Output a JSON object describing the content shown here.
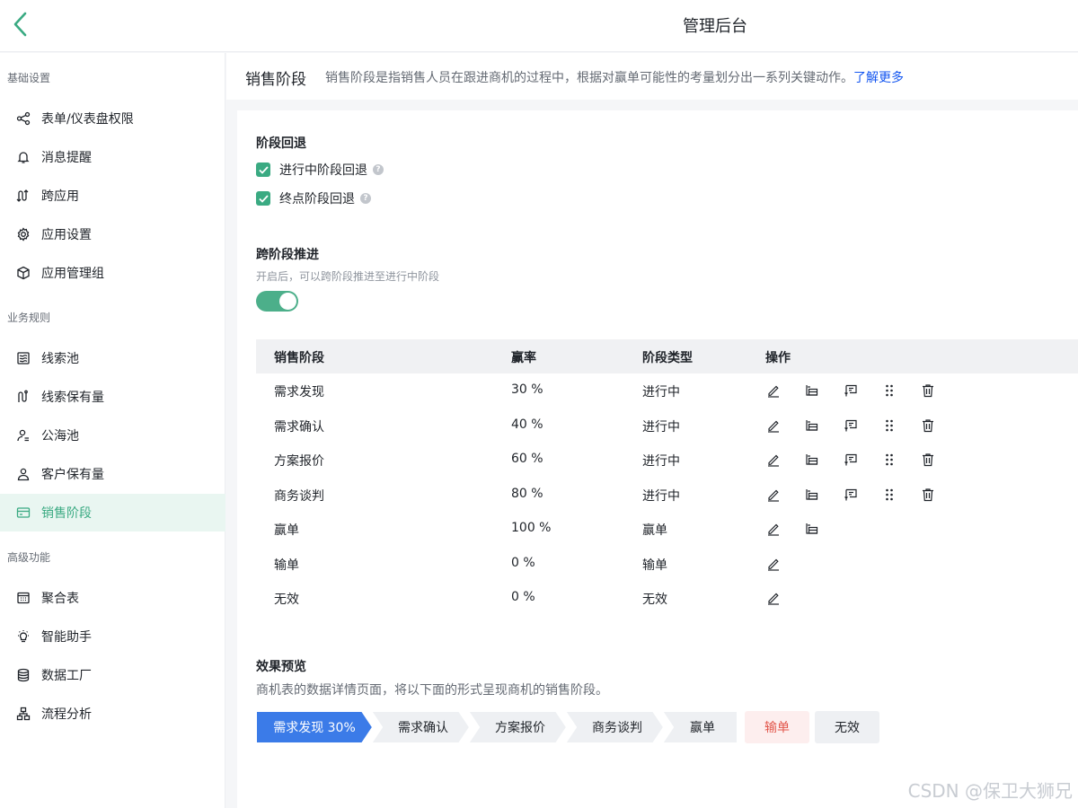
{
  "header": {
    "title": "管理后台"
  },
  "sidebar": {
    "groups": [
      {
        "title": "基础设置",
        "items": [
          {
            "label": "表单/仪表盘权限",
            "icon": "share-icon"
          },
          {
            "label": "消息提醒",
            "icon": "bell-icon"
          },
          {
            "label": "跨应用",
            "icon": "cross-app-icon"
          },
          {
            "label": "应用设置",
            "icon": "gear-icon"
          },
          {
            "label": "应用管理组",
            "icon": "cube-icon"
          }
        ]
      },
      {
        "title": "业务规则",
        "items": [
          {
            "label": "线索池",
            "icon": "pool-icon"
          },
          {
            "label": "线索保有量",
            "icon": "route-icon"
          },
          {
            "label": "公海池",
            "icon": "users-icon"
          },
          {
            "label": "客户保有量",
            "icon": "user-icon"
          },
          {
            "label": "销售阶段",
            "icon": "card-icon",
            "active": true
          }
        ]
      },
      {
        "title": "高级功能",
        "items": [
          {
            "label": "聚合表",
            "icon": "calendar-icon"
          },
          {
            "label": "智能助手",
            "icon": "bulb-icon"
          },
          {
            "label": "数据工厂",
            "icon": "database-icon"
          },
          {
            "label": "流程分析",
            "icon": "flow-icon"
          }
        ]
      }
    ]
  },
  "page": {
    "title": "销售阶段",
    "description": "销售阶段是指销售人员在跟进商机的过程中，根据对赢单可能性的考量划分出一系列关键动作。",
    "learn_more": "了解更多"
  },
  "rollback": {
    "title": "阶段回退",
    "options": [
      {
        "label": "进行中阶段回退",
        "checked": true
      },
      {
        "label": "终点阶段回退",
        "checked": true
      }
    ],
    "help_glyph": "?"
  },
  "cross_stage": {
    "title": "跨阶段推进",
    "hint": "开启后，可以跨阶段推进至进行中阶段",
    "enabled": true
  },
  "table": {
    "headers": [
      "销售阶段",
      "赢率",
      "阶段类型",
      "操作"
    ],
    "rows": [
      {
        "stage": "需求发现",
        "rate": "30 %",
        "type": "进行中",
        "ops": [
          "edit-icon",
          "branch-icon",
          "message-icon",
          "drag-icon",
          "trash-icon"
        ]
      },
      {
        "stage": "需求确认",
        "rate": "40 %",
        "type": "进行中",
        "ops": [
          "edit-icon",
          "branch-icon",
          "message-icon",
          "drag-icon",
          "trash-icon"
        ]
      },
      {
        "stage": "方案报价",
        "rate": "60 %",
        "type": "进行中",
        "ops": [
          "edit-icon",
          "branch-icon",
          "message-icon",
          "drag-icon",
          "trash-icon"
        ]
      },
      {
        "stage": "商务谈判",
        "rate": "80 %",
        "type": "进行中",
        "ops": [
          "edit-icon",
          "branch-icon",
          "message-icon",
          "drag-icon",
          "trash-icon"
        ]
      },
      {
        "stage": "赢单",
        "rate": "100 %",
        "type": "赢单",
        "ops": [
          "edit-icon",
          "branch-icon"
        ]
      },
      {
        "stage": "输单",
        "rate": "0 %",
        "type": "输单",
        "ops": [
          "edit-icon"
        ]
      },
      {
        "stage": "无效",
        "rate": "0 %",
        "type": "无效",
        "ops": [
          "edit-icon"
        ]
      }
    ]
  },
  "preview": {
    "title": "效果预览",
    "hint": "商机表的数据详情页面，将以下面的形式呈现商机的销售阶段。",
    "steps": [
      "需求发现 30%",
      "需求确认",
      "方案报价",
      "商务谈判",
      "赢单"
    ],
    "end_states": [
      "输单",
      "无效"
    ],
    "colors": {
      "active": "#3b7be8",
      "inactive": "#eef0f3",
      "lost_bg": "#fdeeee",
      "lost_text": "#e2574c",
      "accent": "#3aaa82"
    }
  },
  "watermark": "CSDN @保卫大狮兄"
}
